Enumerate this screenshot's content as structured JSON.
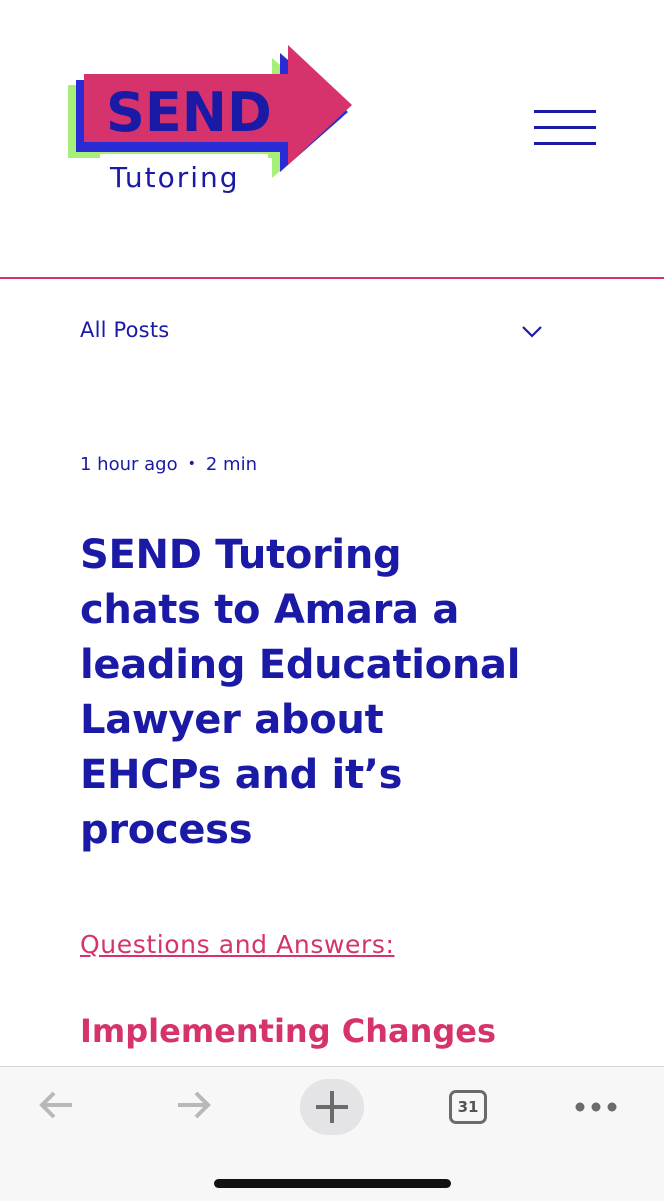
{
  "logo": {
    "word": "SEND",
    "subword": "Tutoring",
    "colors": {
      "arrow": "#d6336c",
      "shadow_blue": "#2b2bd6",
      "shadow_green": "#a6f07a",
      "text": "#1a1aa6"
    }
  },
  "header": {
    "menu_icon": "hamburger-icon"
  },
  "filter": {
    "label": "All Posts",
    "icon": "chevron-down-icon"
  },
  "post": {
    "time_ago": "1 hour ago",
    "separator": "•",
    "read_time": "2 min",
    "title_lines": [
      "SEND Tutoring",
      "chats to Amara a",
      "leading Educational",
      "Lawyer about",
      "EHCPs and it’s",
      "process"
    ],
    "qa_link": "Questions and Answers:",
    "subheading": "Implementing Changes"
  },
  "toolbar": {
    "back_icon": "back-arrow-icon",
    "forward_icon": "forward-arrow-icon",
    "new_tab_icon": "plus-icon",
    "tab_count": "31",
    "more_icon": "more-dots-icon"
  },
  "colors": {
    "primary": "#1a1aa6",
    "accent": "#d6336c",
    "toolbar_bg": "#f7f7f7"
  }
}
